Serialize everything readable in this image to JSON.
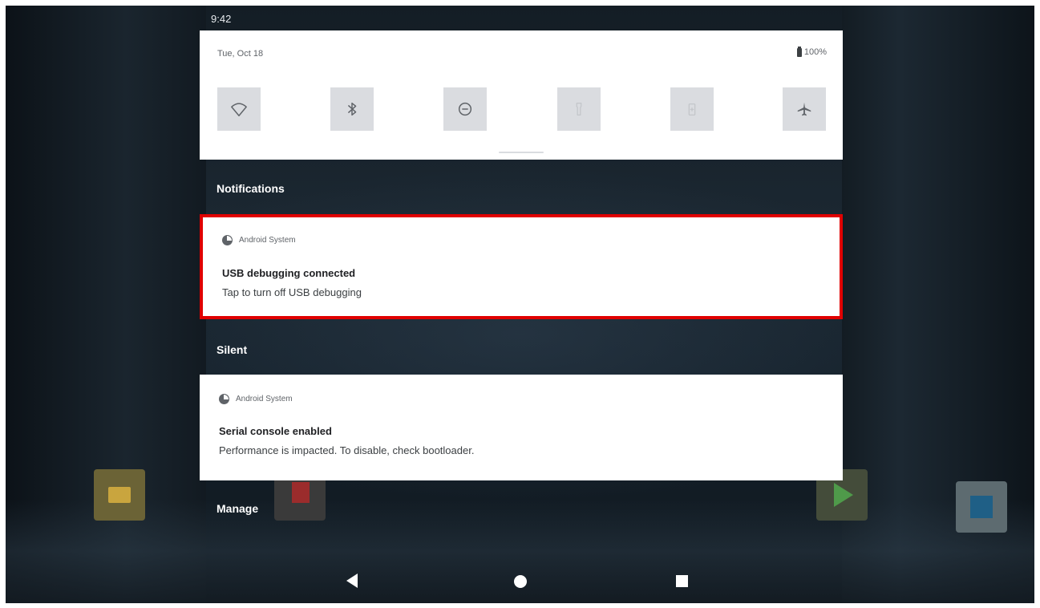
{
  "status_bar": {
    "time": "9:42"
  },
  "quick_settings": {
    "date": "Tue, Oct 18",
    "battery": "100%",
    "tiles": [
      {
        "icon": "wifi-icon"
      },
      {
        "icon": "bluetooth-icon"
      },
      {
        "icon": "do-not-disturb-icon"
      },
      {
        "icon": "flashlight-icon"
      },
      {
        "icon": "battery-saver-icon"
      },
      {
        "icon": "airplane-mode-icon"
      }
    ]
  },
  "sections": {
    "notifications": "Notifications",
    "silent": "Silent",
    "manage": "Manage"
  },
  "notifications": [
    {
      "app": "Android System",
      "title": "USB debugging connected",
      "text": "Tap to turn off USB debugging"
    },
    {
      "app": "Android System",
      "title": "Serial console enabled",
      "text": "Performance is impacted. To disable, check bootloader."
    }
  ],
  "colors": {
    "highlight": "#e00000",
    "panel": "#ffffff",
    "tile": "#dadce0"
  }
}
